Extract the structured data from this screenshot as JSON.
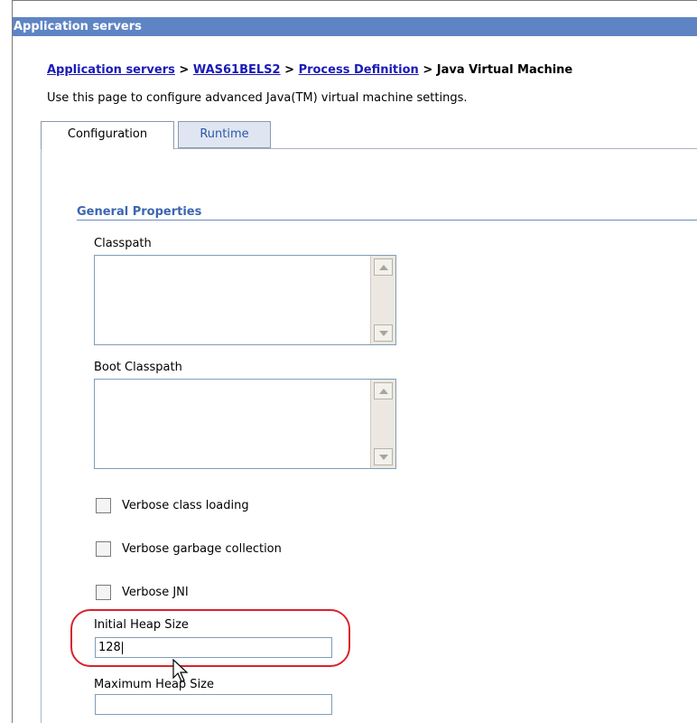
{
  "panel": {
    "title": "Application servers"
  },
  "breadcrumb": {
    "items": [
      "Application servers",
      "WAS61BELS2",
      "Process Definition"
    ],
    "separator": ">",
    "current": "Java Virtual Machine"
  },
  "description": "Use this page to configure advanced Java(TM) virtual machine settings.",
  "tabs": [
    {
      "label": "Configuration",
      "active": true
    },
    {
      "label": "Runtime",
      "active": false
    }
  ],
  "section": {
    "title": "General Properties",
    "classpath_label": "Classpath",
    "classpath_value": "",
    "boot_classpath_label": "Boot Classpath",
    "boot_classpath_value": "",
    "checkboxes": [
      {
        "label": "Verbose class loading",
        "checked": false
      },
      {
        "label": "Verbose garbage collection",
        "checked": false
      },
      {
        "label": "Verbose JNI",
        "checked": false
      }
    ],
    "initial_heap_label": "Initial Heap Size",
    "initial_heap_value": "128",
    "max_heap_label": "Maximum Heap Size",
    "max_heap_value": ""
  },
  "colors": {
    "title_bar": "#5f84c4",
    "link": "#1a1ab8",
    "section_title": "#3a66b0",
    "highlight": "#d9232e"
  }
}
